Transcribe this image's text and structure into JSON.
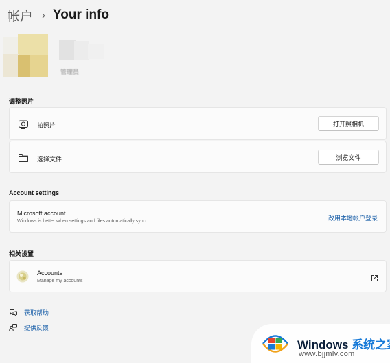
{
  "breadcrumb": {
    "parent": "帐户",
    "separator": "›",
    "current": "Your info"
  },
  "profile": {
    "role": "管理员"
  },
  "photo_section": {
    "title": "调整照片",
    "take_photo": {
      "icon": "camera-icon",
      "label": "拍照片",
      "button": "打开照相机"
    },
    "choose_file": {
      "icon": "folder-icon",
      "label": "选择文件",
      "button": "浏览文件"
    }
  },
  "account_settings": {
    "title": "Account settings",
    "microsoft_account": {
      "title": "Microsoft account",
      "subtitle": "Windows is better when settings and files automatically sync",
      "link": "改用本地帐户登录"
    }
  },
  "related": {
    "title": "相关设置",
    "accounts": {
      "icon": "accounts-icon",
      "title": "Accounts",
      "subtitle": "Manage my accounts",
      "action_icon": "external-link-icon"
    }
  },
  "help": {
    "get_help": {
      "icon": "help-icon",
      "label": "获取帮助"
    },
    "feedback": {
      "icon": "feedback-icon",
      "label": "提供反馈"
    }
  },
  "watermark": {
    "brand": "Windows",
    "brand_cn": "系统之家",
    "url": "www.bjjmlv.com"
  },
  "colors": {
    "background": "#f3f3f3",
    "card": "#fbfbfb",
    "link": "#1a5fa8"
  }
}
